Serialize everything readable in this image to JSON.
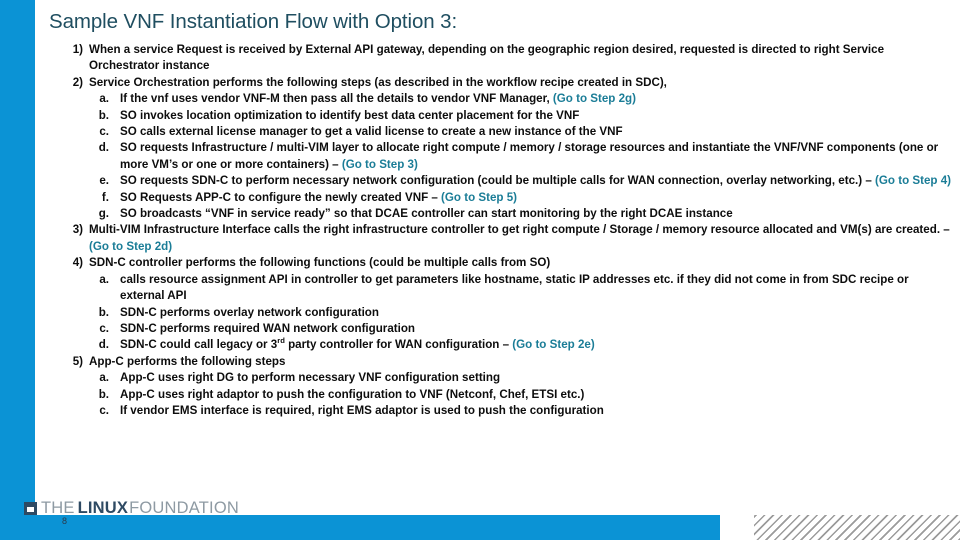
{
  "slide": {
    "title": "Sample VNF Instantiation Flow with Option 3:",
    "page_number": "8",
    "accent_blue": "#0b93d5",
    "title_color": "#1f4e60",
    "reference_color": "#1b7d97"
  },
  "footer": {
    "logo_the": "THE",
    "logo_linux": "LINUX",
    "logo_foundation": "FOUNDATION"
  },
  "steps": [
    {
      "marker": "1)",
      "text": "When a service Request is received by External API gateway, depending on the geographic region desired, requested is directed to right Service Orchestrator instance",
      "sub": []
    },
    {
      "marker": "2)",
      "text": "Service Orchestration performs the following steps (as described in the workflow recipe created in SDC),",
      "sub": [
        {
          "marker": "a.",
          "text": "If the vnf uses vendor VNF-M then pass all the details to vendor VNF Manager, ",
          "ref": "(Go to Step 2g)",
          "tail": ""
        },
        {
          "marker": "b.",
          "text": "SO invokes location optimization to identify best data center placement for the VNF",
          "ref": "",
          "tail": ""
        },
        {
          "marker": "c.",
          "text": "SO calls external license manager to get a valid license to create a new instance of the VNF",
          "ref": "",
          "tail": ""
        },
        {
          "marker": "d.",
          "text": "SO requests Infrastructure / multi-VIM layer to allocate right compute / memory / storage resources and instantiate the VNF/VNF components (one or more VM’s or one or more containers) – ",
          "ref": "(Go to Step 3)",
          "tail": ""
        },
        {
          "marker": "e.",
          "text": "SO requests SDN-C to perform necessary network configuration (could be multiple calls for WAN connection, overlay networking, etc.) – ",
          "ref": "(Go to Step 4)",
          "tail": ""
        },
        {
          "marker": "f.",
          "text": "SO Requests APP-C to configure the newly created VNF – ",
          "ref": "(Go to Step 5)",
          "tail": ""
        },
        {
          "marker": "g.",
          "text": "SO broadcasts “VNF in service ready” so that DCAE controller can start monitoring by the right DCAE instance",
          "ref": "",
          "tail": ""
        }
      ]
    },
    {
      "marker": "3)",
      "text": "Multi-VIM Infrastructure Interface calls the right infrastructure controller to get right compute / Storage / memory resource allocated and VM(s) are created. – ",
      "ref": "(Go to Step 2d)",
      "sub": []
    },
    {
      "marker": "4)",
      "text": "SDN-C controller performs the following functions (could be multiple calls from SO)",
      "sub": [
        {
          "marker": "a.",
          "text": "calls resource assignment API in controller to get parameters like hostname, static IP addresses etc. if they did not come in from SDC recipe or external API",
          "ref": "",
          "tail": ""
        },
        {
          "marker": "b.",
          "text": "SDN-C performs overlay network configuration",
          "ref": "",
          "tail": ""
        },
        {
          "marker": "c.",
          "text": "SDN-C performs required WAN network configuration",
          "ref": "",
          "tail": ""
        },
        {
          "marker": "d.",
          "text_pre": "SDN-C could call legacy or 3",
          "superscript": "rd",
          "text_post": " party controller for WAN configuration – ",
          "ref": "(Go to Step 2e)",
          "tail": ""
        }
      ]
    },
    {
      "marker": "5)",
      "text": "App-C performs the following steps",
      "sub": [
        {
          "marker": "a.",
          "text": "App-C uses right DG to perform necessary VNF configuration setting",
          "ref": "",
          "tail": ""
        },
        {
          "marker": "b.",
          "text": "App-C uses right adaptor to push the configuration to VNF (Netconf, Chef, ETSI etc.)",
          "ref": "",
          "tail": ""
        },
        {
          "marker": "c.",
          "text": "If vendor EMS interface is required, right EMS adaptor is used to push the configuration",
          "ref": "",
          "tail": ""
        }
      ]
    }
  ]
}
